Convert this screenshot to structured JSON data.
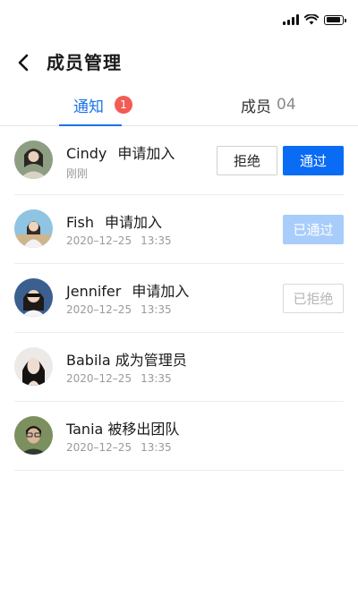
{
  "header": {
    "title": "成员管理"
  },
  "tabs": {
    "notify": {
      "label": "通知",
      "badge": "1"
    },
    "members": {
      "label": "成员",
      "count": "04"
    }
  },
  "notifications": [
    {
      "name": "Cindy",
      "action": "申请加入",
      "time": "刚刚",
      "time2": "",
      "reject_label": "拒绝",
      "approve_label": "通过"
    },
    {
      "name": "Fish",
      "action": "申请加入",
      "time": "2020–12–25",
      "time2": "13:35",
      "status": "已通过"
    },
    {
      "name": "Jennifer",
      "action": "申请加入",
      "time": "2020–12–25",
      "time2": "13:35",
      "status": "已拒绝"
    },
    {
      "name": "Babila",
      "action": "成为管理员",
      "time": "2020–12–25",
      "time2": "13:35"
    },
    {
      "name": "Tania",
      "action": "被移出团队",
      "time": "2020–12–25",
      "time2": "13:35"
    }
  ]
}
